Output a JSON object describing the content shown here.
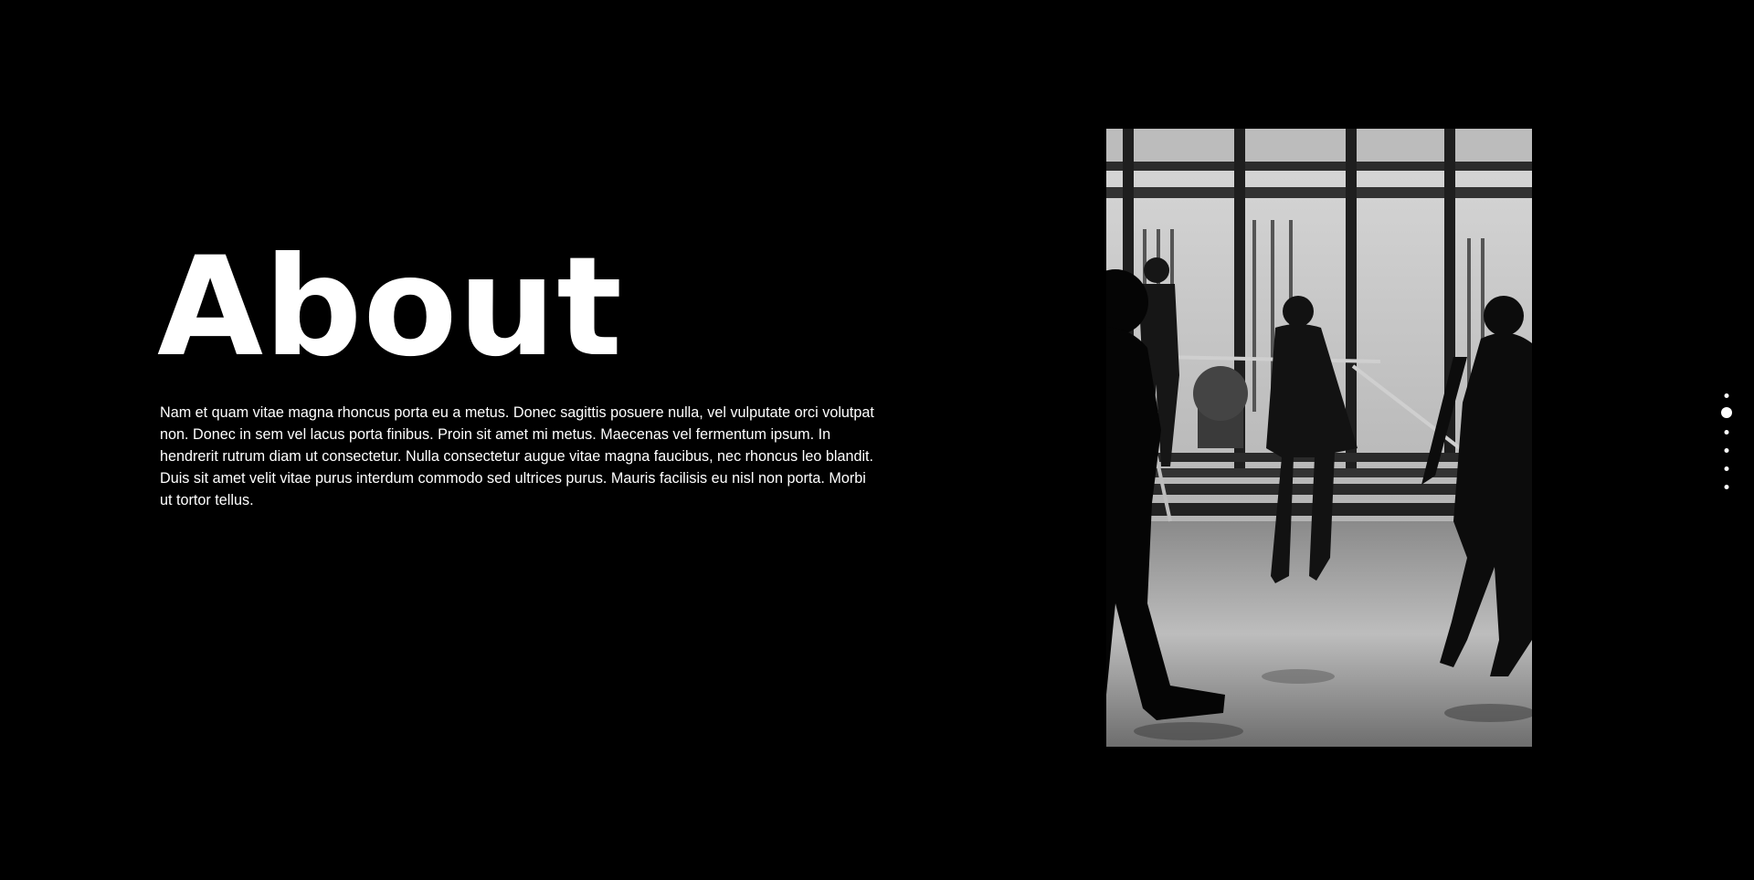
{
  "about": {
    "title": "About",
    "body": "Nam et quam vitae magna rhoncus porta eu a metus. Donec sagittis posuere nulla, vel vulputate orci volutpat non. Donec in sem vel lacus porta finibus. Proin sit amet mi metus. Maecenas vel fermentum ipsum. In hendrerit rutrum diam ut consectetur. Nulla consectetur augue vitae magna faucibus, nec rhoncus leo blandit. Duis sit amet velit vitae purus interdum commodo sed ultrices purus. Mauris facilisis eu nisl non porta. Morbi ut tortor tellus."
  },
  "photo": {
    "description_icon": "black-and-white-photo-people-walking-lobby",
    "aria_label": ""
  },
  "nav_dots": {
    "count": 6,
    "active_index": 1
  },
  "colors": {
    "background": "#000000",
    "text": "#ffffff",
    "dot": "#ffffff"
  }
}
